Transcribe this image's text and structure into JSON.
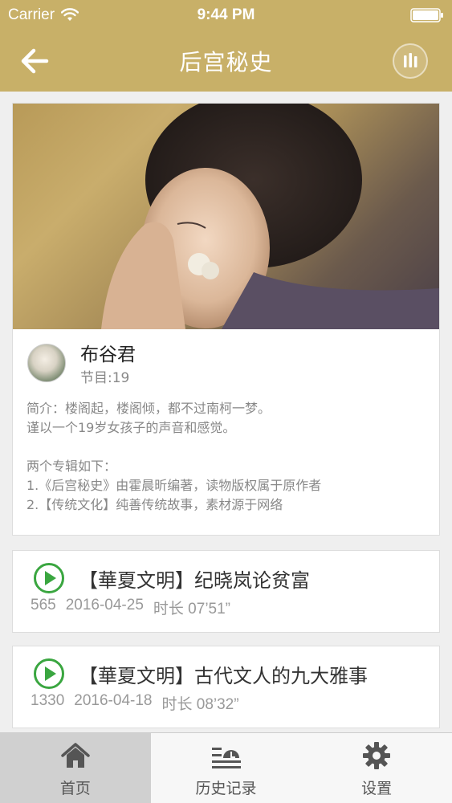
{
  "status_bar": {
    "carrier": "Carrier",
    "time": "9:44 PM"
  },
  "nav": {
    "title": "后宫秘史",
    "back_icon": "arrow-left-icon",
    "player_icon": "equalizer-icon"
  },
  "album": {
    "host_name": "布谷君",
    "episode_count": "节目:19",
    "description_lines": [
      "简介：楼阁起，楼阁倾，都不过南柯一梦。",
      "谨以一个19岁女孩子的声音和感觉。",
      "",
      "两个专辑如下：",
      "1.《后宫秘史》由霍晨昕编著，读物版权属于原作者",
      "2.【传统文化】纯善传统故事，素材源于网络"
    ]
  },
  "episodes": [
    {
      "title": "【華夏文明】纪晓岚论贫富",
      "plays": "565",
      "date": "2016-04-25",
      "duration": "时长 07’51”"
    },
    {
      "title": "【華夏文明】古代文人的九大雅事",
      "plays": "1330",
      "date": "2016-04-18",
      "duration": "时长 08’32”"
    }
  ],
  "tabs": [
    {
      "label": "首页",
      "icon": "home-icon",
      "active": true
    },
    {
      "label": "历史记录",
      "icon": "history-icon",
      "active": false
    },
    {
      "label": "设置",
      "icon": "gear-icon",
      "active": false
    }
  ],
  "colors": {
    "header": "#c8b068",
    "play_accent": "#3aa640",
    "active_tab": "#d0d0d0"
  }
}
